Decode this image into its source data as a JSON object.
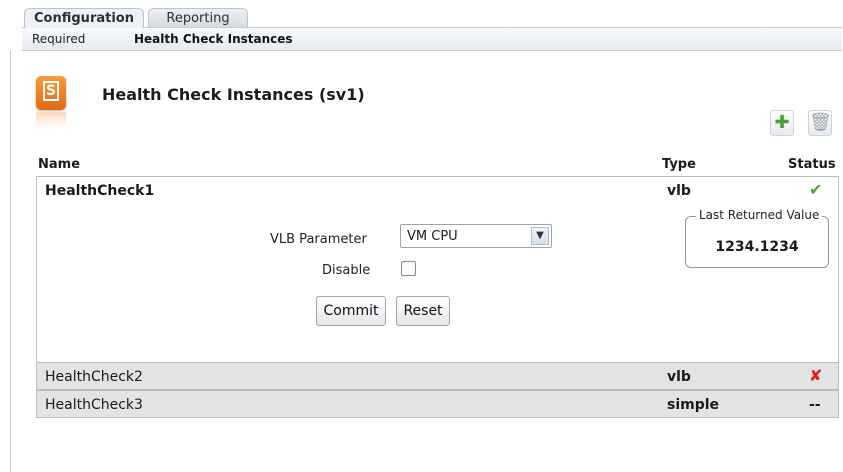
{
  "tabs": [
    {
      "label": "Configuration"
    },
    {
      "label": "Reporting"
    }
  ],
  "subtabs": [
    {
      "label": "Required"
    },
    {
      "label": "Health Check Instances"
    }
  ],
  "header": {
    "title": "Health Check Instances (sv1)",
    "icon_letter": "S"
  },
  "toolbar": {
    "add_symbol": "✚",
    "delete_symbol": "🗑"
  },
  "table": {
    "columns": [
      "Name",
      "Type",
      "Status"
    ],
    "rows": [
      {
        "name": "HealthCheck1",
        "type": "vlb",
        "status_symbol": "✔",
        "status": "ok"
      },
      {
        "name": "HealthCheck2",
        "type": "vlb",
        "status_symbol": "✘",
        "status": "error"
      },
      {
        "name": "HealthCheck3",
        "type": "simple",
        "status_symbol": "--",
        "status": "none"
      }
    ]
  },
  "detail": {
    "vlb_parameter_label": "VLB Parameter",
    "vlb_parameter_value": "VM CPU",
    "disable_label": "Disable",
    "disable_checked": false,
    "commit_label": "Commit",
    "reset_label": "Reset",
    "last_returned_label": "Last Returned Value",
    "last_returned_value": "1234.1234"
  },
  "colors": {
    "ok": "#4aa436",
    "error": "#e3141b",
    "icon_orange": "#f08a2c"
  }
}
